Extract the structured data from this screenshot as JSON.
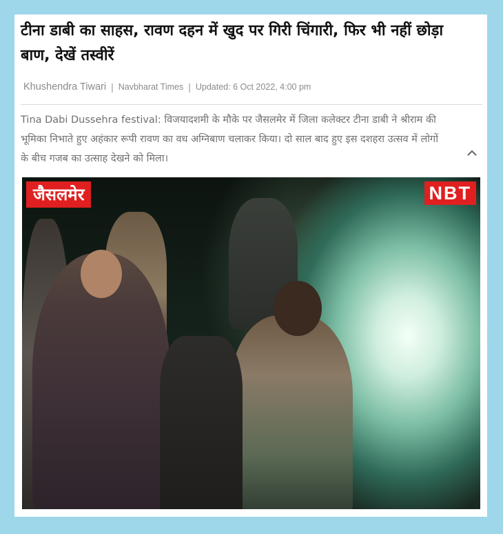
{
  "article": {
    "headline": "टीना डाबी का साहस, रावण दहन में खुद पर गिरी चिंगारी, फिर भी नहीं छोड़ा बाण, देखें तस्वीरें",
    "author": "Khushendra Tiwari",
    "separator": "|",
    "source": "Navbharat Times",
    "updated": "Updated: 6 Oct 2022, 4:00 pm",
    "summary": "Tina Dabi Dussehra festival: विजयादशमी के मौके पर जैसलमेर में जिला कलेक्टर टीना डाबी ने श्रीराम की भूमिका निभाते हुए अहंकार रूपी रावण का वध अग्निबाण चलाकर किया। दो साल बाद हुए इस दशहरा उत्सव में लोगों के बीच गजब का उत्साह देखने को मिला।",
    "collapse_icon": "chevron-up-icon"
  },
  "photo": {
    "place_tag": "जैसलमेर",
    "logo": "NBT"
  },
  "colors": {
    "page_background": "#9ed7ea",
    "card_background": "#ffffff",
    "badge_red": "#e02020",
    "meta_gray": "#8a8a8a"
  }
}
